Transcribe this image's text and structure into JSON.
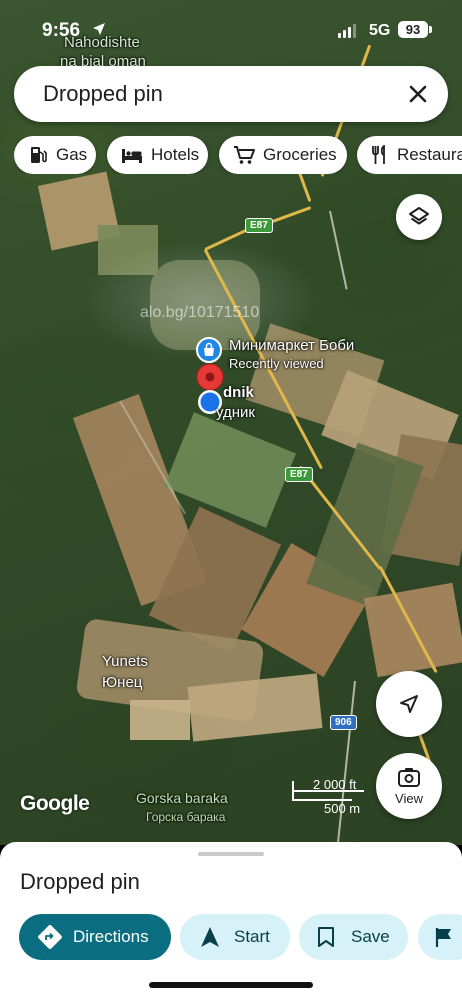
{
  "status_bar": {
    "time": "9:56",
    "network": "5G",
    "battery": "93"
  },
  "map": {
    "background_labels": [
      {
        "text": "Nahodishte"
      },
      {
        "text": "na bial oman"
      }
    ],
    "watermark": "alo.bg/10171510",
    "poi": {
      "name": "Минимаркет Боби",
      "subtitle": "Recently viewed"
    },
    "village": {
      "name_latin": "dnik",
      "name_cyrillic": "удник"
    },
    "yunets": {
      "name_latin": "Yunets",
      "name_cyrillic": "Юнец"
    },
    "gorska": {
      "name_latin": "Gorska baraka",
      "name_cyrillic": "Горска барака"
    },
    "road_shields": [
      {
        "label": "E87",
        "color": "#3d9a3a"
      },
      {
        "label": "E87",
        "color": "#3d9a3a"
      },
      {
        "label": "906",
        "color": "#2f6fbf"
      }
    ],
    "google_logo": "Google",
    "scale": {
      "top": "2 000 ft",
      "bottom": "500 m"
    },
    "view_button_label": "View",
    "layers_icon": "layers-icon",
    "locate_icon": "navigation-arrow-icon"
  },
  "search": {
    "value": "Dropped pin"
  },
  "chips": [
    {
      "label": "Gas",
      "icon": "gas-station-icon"
    },
    {
      "label": "Hotels",
      "icon": "bed-icon"
    },
    {
      "label": "Groceries",
      "icon": "cart-icon"
    },
    {
      "label": "Restaurants",
      "icon": "restaurant-icon"
    }
  ],
  "sheet": {
    "title": "Dropped pin",
    "actions": [
      {
        "label": "Directions",
        "icon": "directions-icon"
      },
      {
        "label": "Start",
        "icon": "navigation-icon"
      },
      {
        "label": "Save",
        "icon": "bookmark-icon"
      },
      {
        "label": "",
        "icon": "flag-icon"
      }
    ]
  },
  "colors": {
    "primary": "#0b6e80",
    "secondary": "#d6f1f8",
    "pin_red": "#e53935",
    "location_blue": "#1a73e8",
    "poi_blue": "#1e88e5"
  }
}
